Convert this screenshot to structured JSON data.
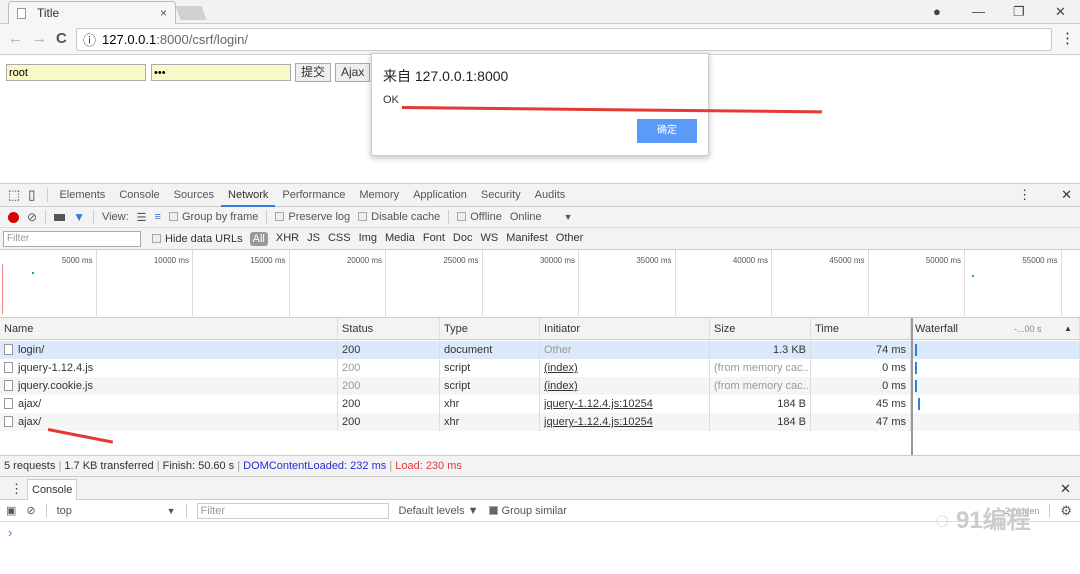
{
  "browser": {
    "tab_title": "Title",
    "tab_close": "×",
    "url_host": "127.0.0.1",
    "url_rest": ":8000/csrf/login/",
    "back": "←",
    "forward": "→",
    "reload": "C",
    "info_icon": "ⓘ",
    "key_icon": "⚷",
    "star_icon": "☆",
    "menu_icon": "⋮",
    "win_profile": "●",
    "win_min": "—",
    "win_restore": "❐",
    "win_close": "✕"
  },
  "page": {
    "username": "root",
    "password": "•••",
    "submit_label": "提交",
    "ajax_label": "Ajax"
  },
  "dialog": {
    "title": "来自 127.0.0.1:8000",
    "message": "OK",
    "ok_label": "确定"
  },
  "devtools": {
    "tabs": [
      "Elements",
      "Console",
      "Sources",
      "Network",
      "Performance",
      "Memory",
      "Application",
      "Security",
      "Audits"
    ],
    "active_tab": "Network",
    "toolbar": {
      "view_label": "View:",
      "group_by_frame": "Group by frame",
      "preserve_log": "Preserve log",
      "disable_cache": "Disable cache",
      "offline": "Offline",
      "throttle": "Online",
      "dropdown": "▼"
    },
    "filter": {
      "placeholder": "Filter",
      "hide_data_urls": "Hide data URLs",
      "types": [
        "All",
        "XHR",
        "JS",
        "CSS",
        "Img",
        "Media",
        "Font",
        "Doc",
        "WS",
        "Manifest",
        "Other"
      ]
    },
    "overview_ticks": [
      "5000 ms",
      "10000 ms",
      "15000 ms",
      "20000 ms",
      "25000 ms",
      "30000 ms",
      "35000 ms",
      "40000 ms",
      "45000 ms",
      "50000 ms",
      "55000 ms"
    ],
    "columns": [
      "Name",
      "Status",
      "Type",
      "Initiator",
      "Size",
      "Time",
      "Waterfall"
    ],
    "waterfall_scale": "-...00 s",
    "rows": [
      {
        "name": "login/",
        "status": "200",
        "type": "document",
        "initiator": "Other",
        "size": "1.3 KB",
        "time": "74 ms"
      },
      {
        "name": "jquery-1.12.4.js",
        "status": "200",
        "type": "script",
        "initiator": "(index)",
        "size": "(from memory cac...",
        "time": "0 ms"
      },
      {
        "name": "jquery.cookie.js",
        "status": "200",
        "type": "script",
        "initiator": "(index)",
        "size": "(from memory cac...",
        "time": "0 ms"
      },
      {
        "name": "ajax/",
        "status": "200",
        "type": "xhr",
        "initiator": "jquery-1.12.4.js:10254",
        "size": "184 B",
        "time": "45 ms"
      },
      {
        "name": "ajax/",
        "status": "200",
        "type": "xhr",
        "initiator": "jquery-1.12.4.js:10254",
        "size": "184 B",
        "time": "47 ms"
      }
    ],
    "status": {
      "requests": "5 requests",
      "transferred": "1.7 KB transferred",
      "finish": "Finish: 50.60 s",
      "dcl": "DOMContentLoaded: 232 ms",
      "load": "Load: 230 ms",
      "dcl_color": "#2a2ad6",
      "load_color": "#e0393e"
    },
    "drawer": {
      "tab": "Console",
      "context": "top",
      "filter_placeholder": "Filter",
      "levels": "Default levels ▼",
      "group_similar": "Group similar",
      "hidden": "2 hidden",
      "prompt": "›"
    }
  },
  "watermark": "91编程"
}
